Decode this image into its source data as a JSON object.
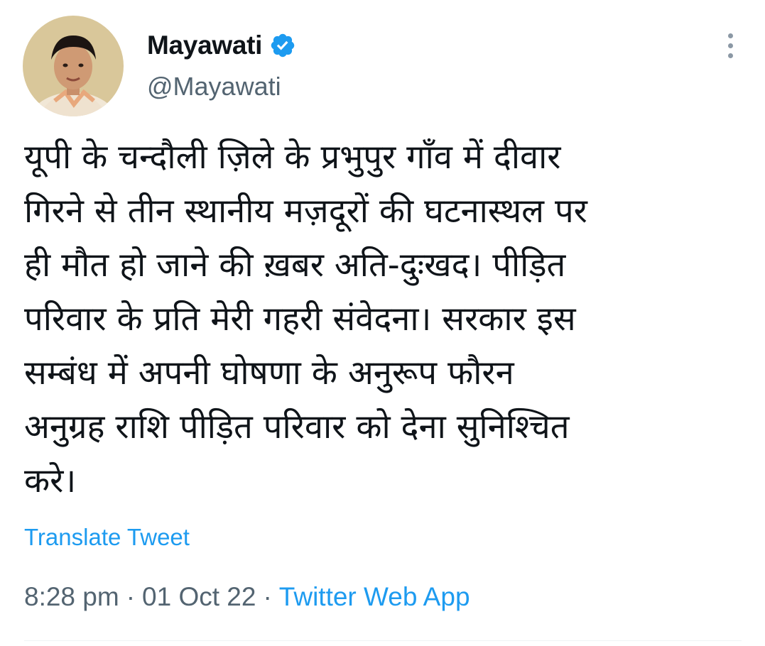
{
  "tweet": {
    "author": {
      "display_name": "Mayawati",
      "handle": "@Mayawati",
      "verified_icon": "verified-badge-icon",
      "avatar": "profile-photo"
    },
    "text": "यूपी के चन्दौली ज़िले के प्रभुपुर गाँव में दीवार\nगिरने से तीन स्थानीय मज़दूरों की घटनास्थल पर\nही मौत हो जाने की ख़बर अति-दुःखद। पीड़ित\nपरिवार के प्रति मेरी गहरी संवेदना। सरकार इस\nसम्बंध में अपनी घोषणा के अनुरूप फौरन\nअनुग्रह राशि पीड़ित परिवार को देना सुनिश्चित\nकरे।",
    "translate_label": "Translate Tweet",
    "time": "8:28 pm",
    "date": "01 Oct 22",
    "separator": "·",
    "source": "Twitter Web App",
    "more_icon": "more-options-icon"
  },
  "colors": {
    "accent": "#1d9bf0",
    "text_primary": "#0f1419",
    "text_secondary": "#536471",
    "divider": "#eff3f4"
  }
}
